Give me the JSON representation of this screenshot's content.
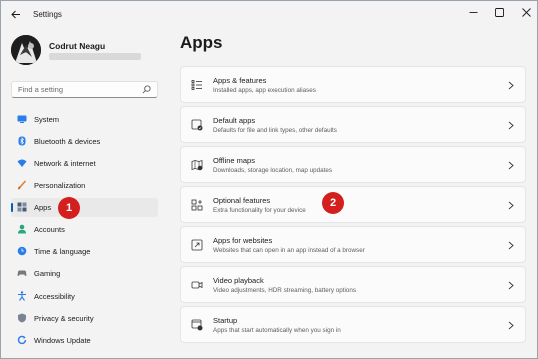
{
  "window": {
    "title": "Settings"
  },
  "profile": {
    "name": "Codrut Neagu"
  },
  "search": {
    "placeholder": "Find a setting"
  },
  "sidebar": {
    "items": [
      {
        "label": "System",
        "icon": "monitor-icon",
        "color": "#2b7de9"
      },
      {
        "label": "Bluetooth & devices",
        "icon": "bluetooth-icon",
        "color": "#2b7de9"
      },
      {
        "label": "Network & internet",
        "icon": "wifi-icon",
        "color": "#2b7de9"
      },
      {
        "label": "Personalization",
        "icon": "brush-icon",
        "color": "#e0822d"
      },
      {
        "label": "Apps",
        "icon": "apps-icon",
        "color": "#4a5a75",
        "active": true
      },
      {
        "label": "Accounts",
        "icon": "person-icon",
        "color": "#2aa87a"
      },
      {
        "label": "Time & language",
        "icon": "globe-clock-icon",
        "color": "#2b7de9"
      },
      {
        "label": "Gaming",
        "icon": "gamepad-icon",
        "color": "#7a7a7a"
      },
      {
        "label": "Accessibility",
        "icon": "accessibility-icon",
        "color": "#2b7de9"
      },
      {
        "label": "Privacy & security",
        "icon": "shield-icon",
        "color": "#7a8391"
      },
      {
        "label": "Windows Update",
        "icon": "update-icon",
        "color": "#2b7de9"
      }
    ]
  },
  "markers": {
    "first": "1",
    "second": "2"
  },
  "main": {
    "title": "Apps",
    "cards": [
      {
        "title": "Apps & features",
        "subtitle": "Installed apps, app execution aliases",
        "icon": "list-icon"
      },
      {
        "title": "Default apps",
        "subtitle": "Defaults for file and link types, other defaults",
        "icon": "default-apps-icon"
      },
      {
        "title": "Offline maps",
        "subtitle": "Downloads, storage location, map updates",
        "icon": "map-icon"
      },
      {
        "title": "Optional features",
        "subtitle": "Extra functionality for your device",
        "icon": "add-grid-icon"
      },
      {
        "title": "Apps for websites",
        "subtitle": "Websites that can open in an app instead of a browser",
        "icon": "web-app-icon"
      },
      {
        "title": "Video playback",
        "subtitle": "Video adjustments, HDR streaming, battery options",
        "icon": "video-icon"
      },
      {
        "title": "Startup",
        "subtitle": "Apps that start automatically when you sign in",
        "icon": "startup-icon"
      }
    ]
  },
  "colors": {
    "accent": "#005fb8",
    "marker": "#d41f1f"
  }
}
